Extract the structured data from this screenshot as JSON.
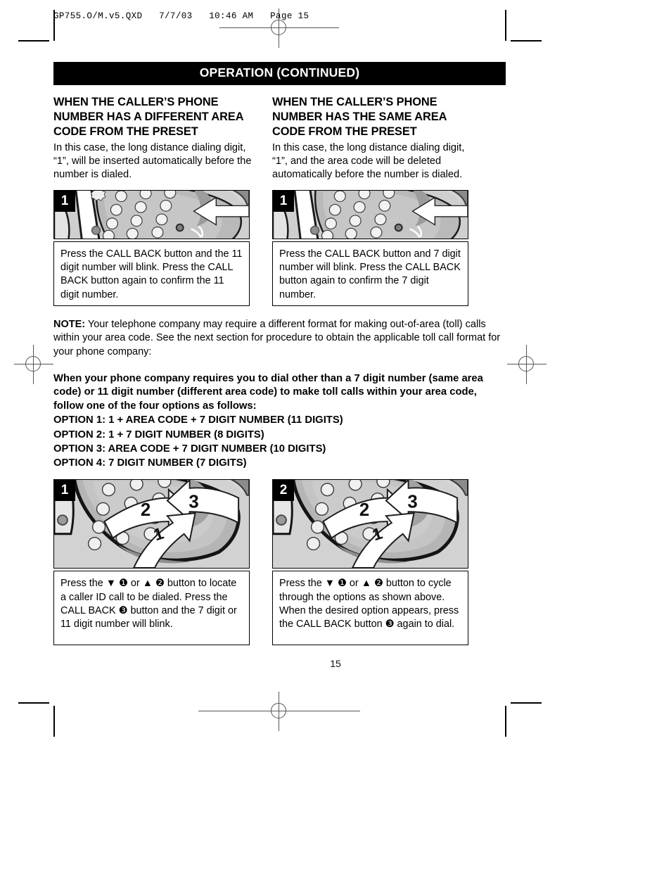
{
  "printer_header": "GP755.O/M.v5.QXD   7/7/03   10:46 AM   Page 15",
  "section_title": "OPERATION (CONTINUED)",
  "page_number": "15",
  "columns": [
    {
      "heading": "WHEN THE CALLER’S PHONE NUMBER HAS A DIFFERENT AREA CODE FROM THE PRESET",
      "body": "In this case, the long distance dialing digit, “1”, will be inserted automatically before the number is dialed.",
      "figure_badge": "1",
      "caption": "Press the CALL BACK button and the 11 digit number will blink. Press the CALL BACK button again to confirm the 11 digit number."
    },
    {
      "heading": "WHEN THE CALLER’S PHONE NUMBER HAS THE SAME AREA CODE FROM THE PRESET",
      "body": "In this case, the long distance dialing digit, “1”, and the area code will be deleted automatically before the number is dialed.",
      "figure_badge": "1",
      "caption": "Press the CALL BACK button and 7 digit number will blink. Press the CALL BACK button again to confirm the 7 digit number."
    }
  ],
  "note": {
    "label": "NOTE:",
    "text": " Your telephone company may require a different format for making out-of-area (toll) calls within your area code. See the next section for procedure to obtain the applicable toll call format for your phone company:"
  },
  "instruction_bold": "When your phone company requires you to dial other than a 7 digit number (same area code) or 11 digit number (different area code) to make toll calls within your area code, follow one of the four options as follows:",
  "options": [
    "OPTION 1: 1 + AREA CODE + 7 DIGIT NUMBER (11 DIGITS)",
    "OPTION 2: 1 + 7 DIGIT NUMBER (8 DIGITS)",
    "OPTION 3: AREA CODE + 7 DIGIT NUMBER (10 DIGITS)",
    "OPTION 4: 7 DIGIT NUMBER (7 DIGITS)"
  ],
  "bottom_columns": [
    {
      "figure_badge": "1",
      "arrow_labels": [
        "1",
        "2",
        "3"
      ],
      "caption": "Press the ▼ ❶ or ▲ ❷ button to locate a caller ID call to be dialed. Press the CALL BACK ❸ button and the 7 digit or 11 digit number will blink."
    },
    {
      "figure_badge": "2",
      "arrow_labels": [
        "1",
        "2",
        "3"
      ],
      "caption": "Press the ▼ ❶ or ▲ ❷ button to cycle through the options as shown above. When the desired option appears, press the CALL BACK button ❸ again to dial."
    }
  ],
  "colors": {
    "bar_background": "#000000",
    "bar_text": "#ffffff",
    "illustration_light": "#cccccc",
    "illustration_mid": "#a8a8a8",
    "illustration_dark": "#7a7a7a",
    "page_background": "#ffffff"
  }
}
